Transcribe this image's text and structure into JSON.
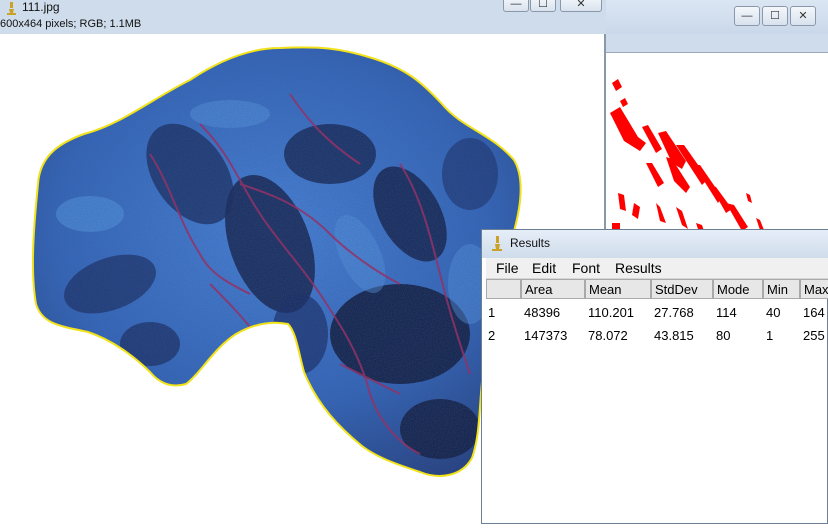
{
  "image_window": {
    "title": "111.jpg",
    "info": "600x464 pixels; RGB; 1.1MB"
  },
  "results_window": {
    "title": "Results",
    "menu": [
      "File",
      "Edit",
      "Font",
      "Results"
    ],
    "columns": [
      "",
      "Area",
      "Mean",
      "StdDev",
      "Mode",
      "Min",
      "Max"
    ],
    "rows": [
      [
        "1",
        "48396",
        "110.201",
        "27.768",
        "114",
        "40",
        "164"
      ],
      [
        "2",
        "147373",
        "78.072",
        "43.815",
        "80",
        "1",
        "255"
      ]
    ]
  },
  "window_controls": {
    "minimize": "—",
    "maximize": "☐",
    "close": "✕"
  },
  "icons": [
    "microscope-icon",
    "minimize-icon",
    "maximize-icon",
    "close-icon"
  ],
  "colors": {
    "selection_outline": "#f2e21a",
    "threshold_red": "#ff0000",
    "rock_blue": "#3a78d8",
    "rock_dark": "#101a3a"
  }
}
